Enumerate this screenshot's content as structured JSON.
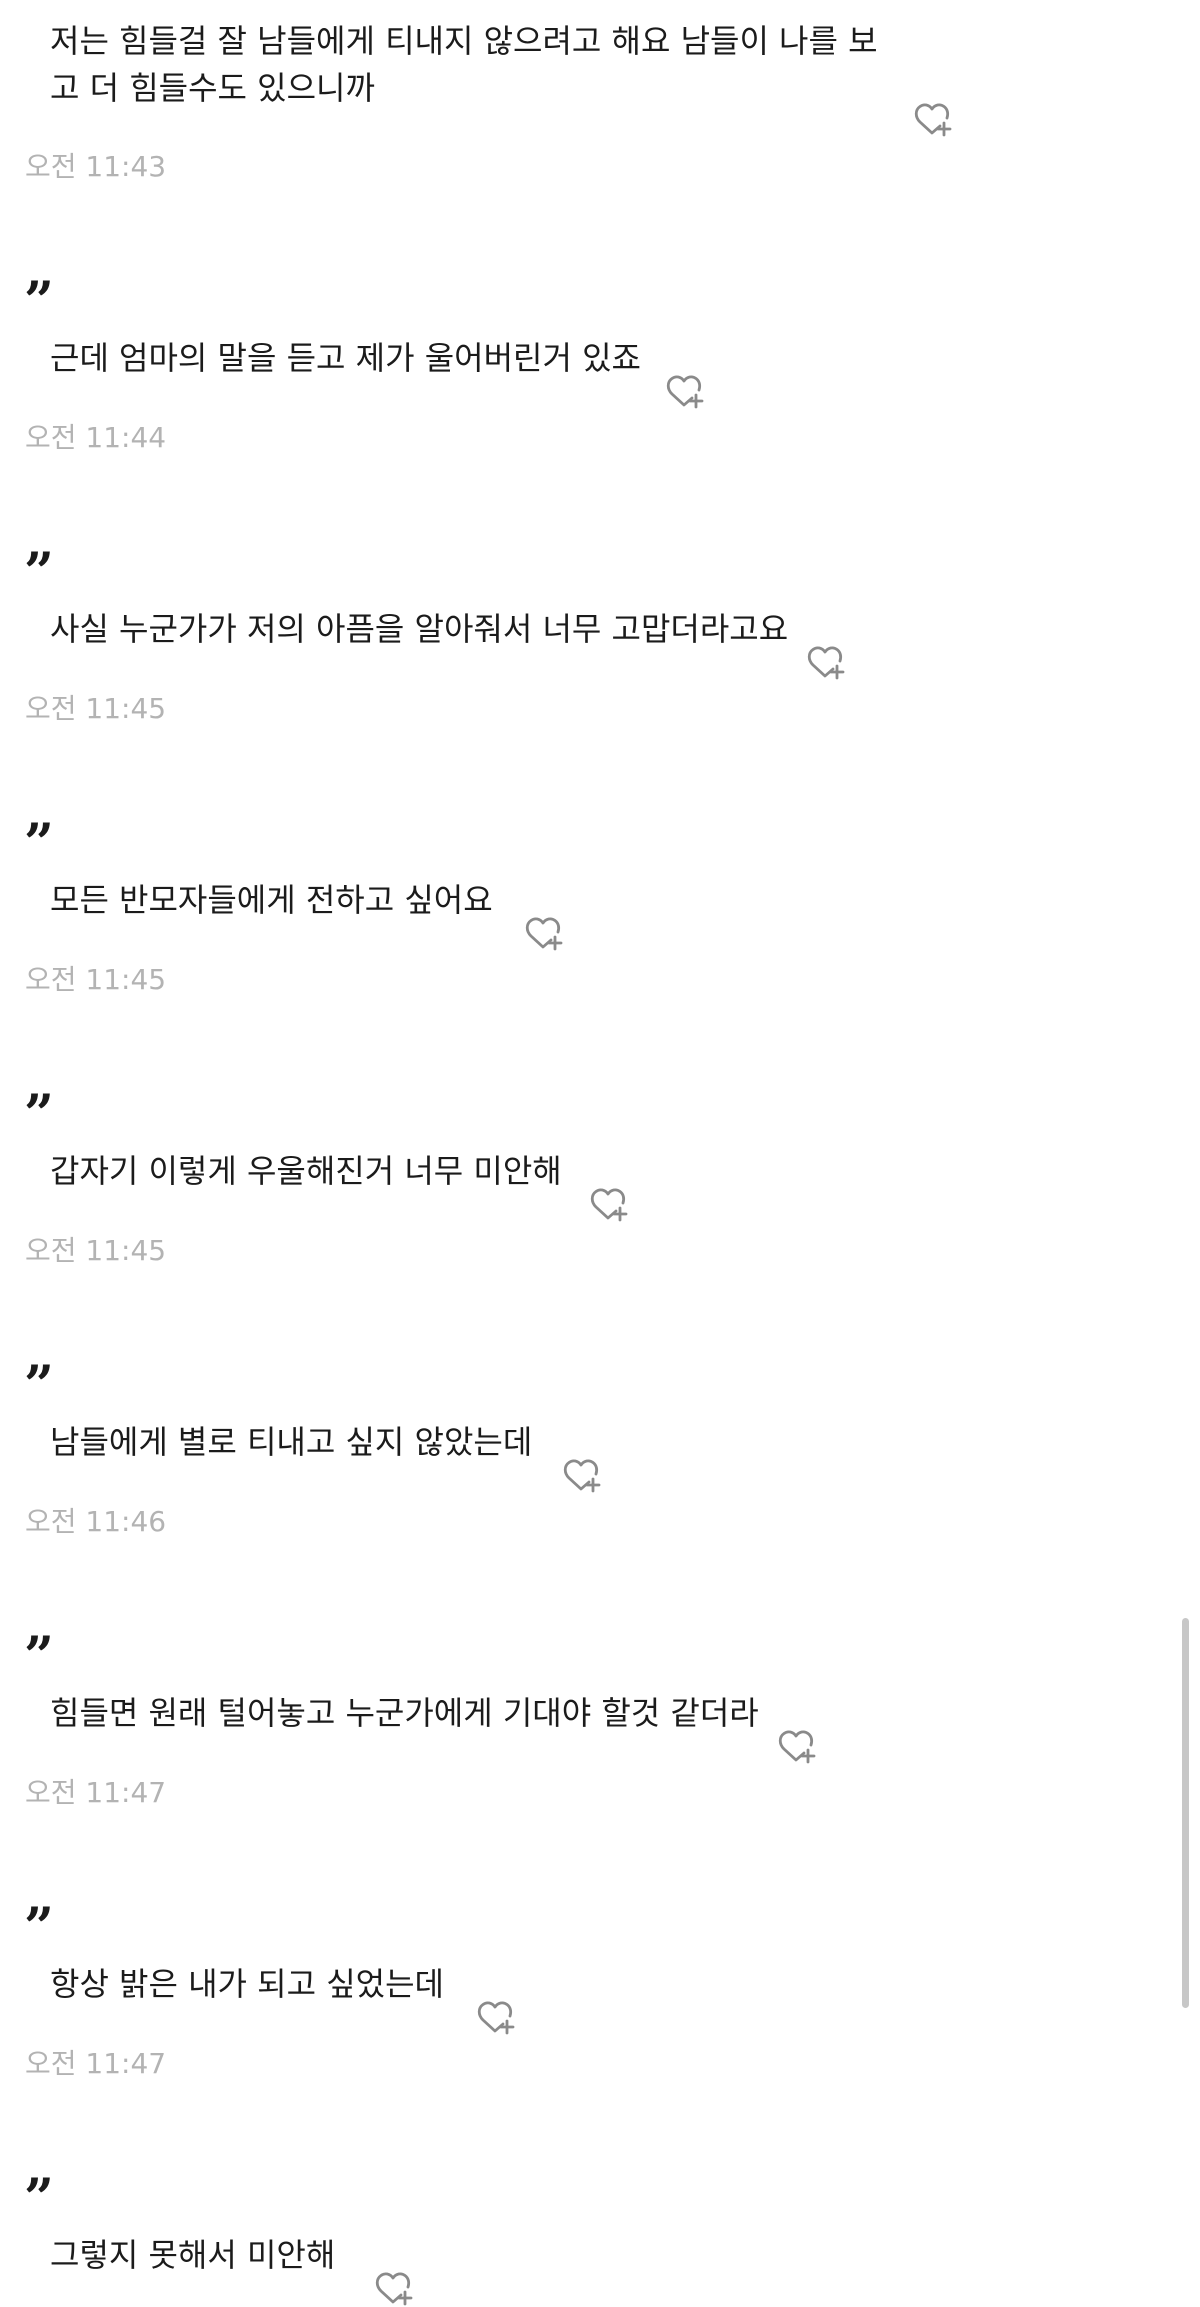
{
  "heart_icon": "heart-plus-icon",
  "colors": {
    "text": "#1b1b1b",
    "timestamp": "#b3b3b3",
    "icon": "#8a8a8a",
    "scrollbar": "#c7c7c7"
  },
  "messages": [
    {
      "quote": "",
      "text": "저는 힘들걸 잘 남들에게 티내지 않으려고 해요 남들이 나를 보\n고 더 힘들수도 있으니까",
      "time": "오전 11:43"
    },
    {
      "quote": "”",
      "text": "근데 엄마의 말을 듣고 제가 울어버린거 있죠",
      "time": "오전 11:44"
    },
    {
      "quote": "”",
      "text": "사실 누군가가 저의 아픔을 알아줘서 너무 고맙더라고요",
      "time": "오전 11:45"
    },
    {
      "quote": "”",
      "text": "모든 반모자들에게 전하고 싶어요",
      "time": "오전 11:45"
    },
    {
      "quote": "”",
      "text": "갑자기 이렇게 우울해진거 너무 미안해",
      "time": "오전 11:45"
    },
    {
      "quote": "”",
      "text": "남들에게 별로 티내고 싶지 않았는데",
      "time": "오전 11:46"
    },
    {
      "quote": "”",
      "text": "힘들면 원래 털어놓고 누군가에게 기대야 할것 같더라",
      "time": "오전 11:47"
    },
    {
      "quote": "”",
      "text": "항상 밝은 내가 되고 싶었는데",
      "time": "오전 11:47"
    },
    {
      "quote": "”",
      "text": "그렇지 못해서 미안해",
      "time": ""
    }
  ]
}
